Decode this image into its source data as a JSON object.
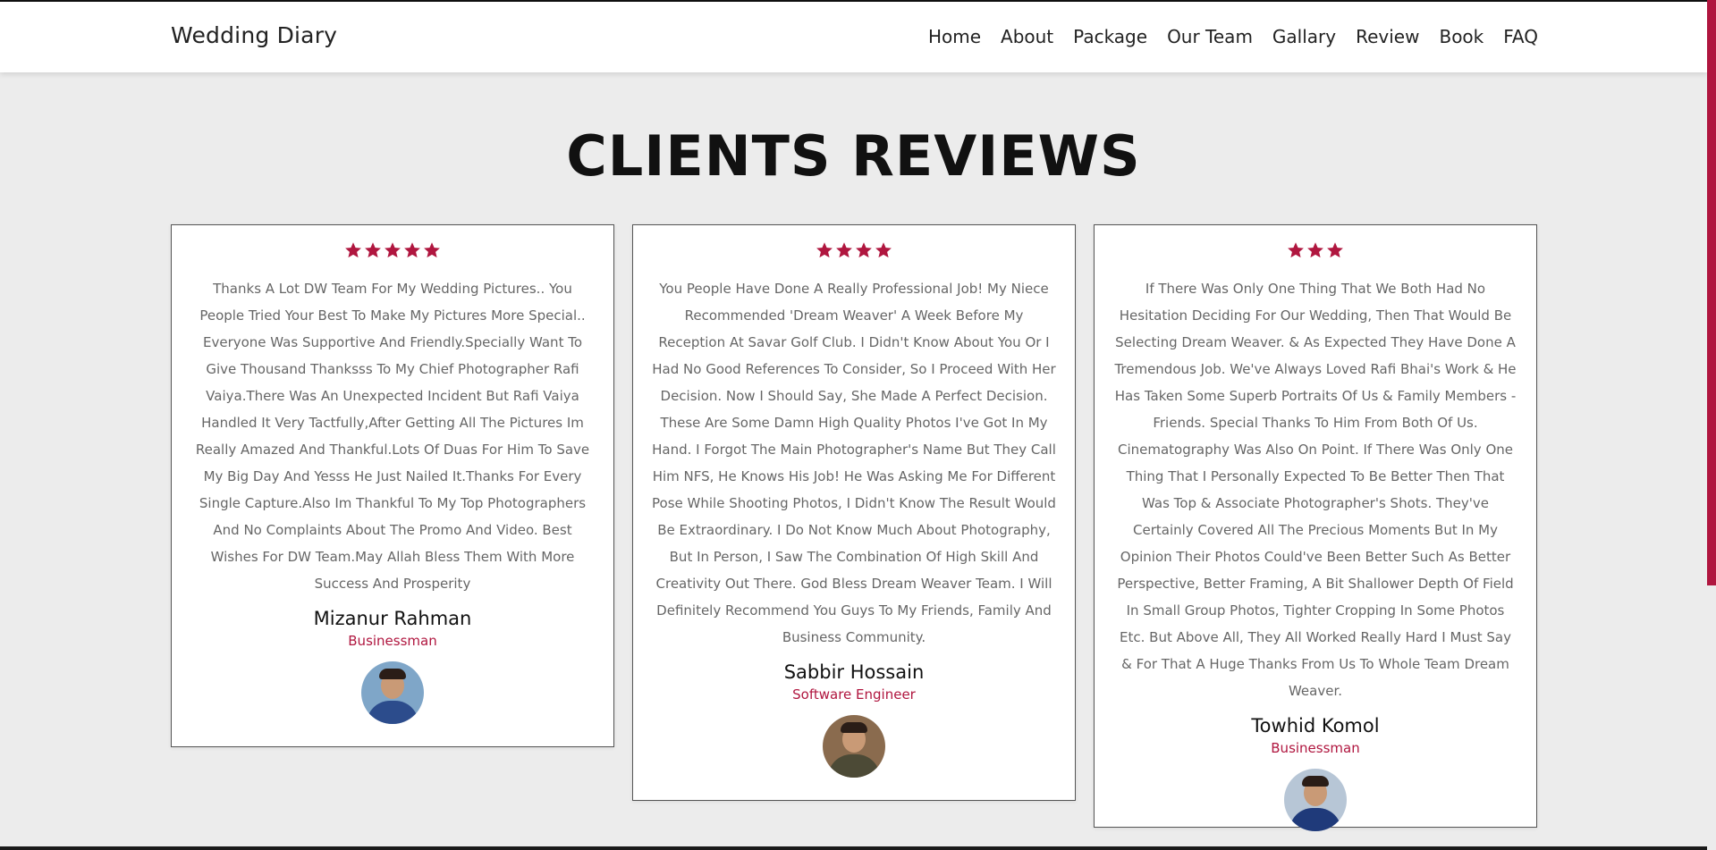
{
  "brand": "Wedding Diary",
  "nav": [
    "Home",
    "About",
    "Package",
    "Our Team",
    "Gallary",
    "Review",
    "Book",
    "FAQ"
  ],
  "section_title": "CLIENTS REVIEWS",
  "colors": {
    "accent": "#b0163f",
    "background": "#ececec"
  },
  "reviews": [
    {
      "rating": 5,
      "text": "Thanks A Lot DW Team For My Wedding Pictures.. You People Tried Your Best To Make My Pictures More Special.. Everyone Was Supportive And Friendly.Specially Want To Give Thousand Thanksss To My Chief Photographer Rafi Vaiya.There Was An Unexpected Incident But Rafi Vaiya Handled It Very Tactfully,After Getting All The Pictures Im Really Amazed And Thankful.Lots Of Duas For Him To Save My Big Day And Yesss He Just Nailed It.Thanks For Every Single Capture.Also Im Thankful To My Top Photographers And No Complaints About The Promo And Video. Best Wishes For DW Team.May Allah Bless Them With More Success And Prosperity",
      "name": "Mizanur Rahman",
      "role": "Businessman"
    },
    {
      "rating": 4,
      "text": "You People Have Done A Really Professional Job! My Niece Recommended 'Dream Weaver' A Week Before My Reception At Savar Golf Club. I Didn't Know About You Or I Had No Good References To Consider, So I Proceed With Her Decision. Now I Should Say, She Made A Perfect Decision. These Are Some Damn High Quality Photos I've Got In My Hand. I Forgot The Main Photographer's Name But They Call Him NFS, He Knows His Job! He Was Asking Me For Different Pose While Shooting Photos, I Didn't Know The Result Would Be Extraordinary. I Do Not Know Much About Photography, But In Person, I Saw The Combination Of High Skill And Creativity Out There. God Bless Dream Weaver Team. I Will Definitely Recommend You Guys To My Friends, Family And Business Community.",
      "name": "Sabbir Hossain",
      "role": "Software Engineer"
    },
    {
      "rating": 3,
      "text": "If There Was Only One Thing That We Both Had No Hesitation Deciding For Our Wedding, Then That Would Be Selecting Dream Weaver. & As Expected They Have Done A Tremendous Job. We've Always Loved Rafi Bhai's Work & He Has Taken Some Superb Portraits Of Us & Family Members - Friends. Special Thanks To Him From Both Of Us. Cinematography Was Also On Point. If There Was Only One Thing That I Personally Expected To Be Better Then That Was Top & Associate Photographer's Shots. They've Certainly Covered All The Precious Moments But In My Opinion Their Photos Could've Been Better Such As Better Perspective, Better Framing, A Bit Shallower Depth Of Field In Small Group Photos, Tighter Cropping In Some Photos Etc. But Above All, They All Worked Really Hard I Must Say & For That A Huge Thanks From Us To Whole Team Dream Weaver.",
      "name": "Towhid Komol",
      "role": "Businessman"
    }
  ]
}
